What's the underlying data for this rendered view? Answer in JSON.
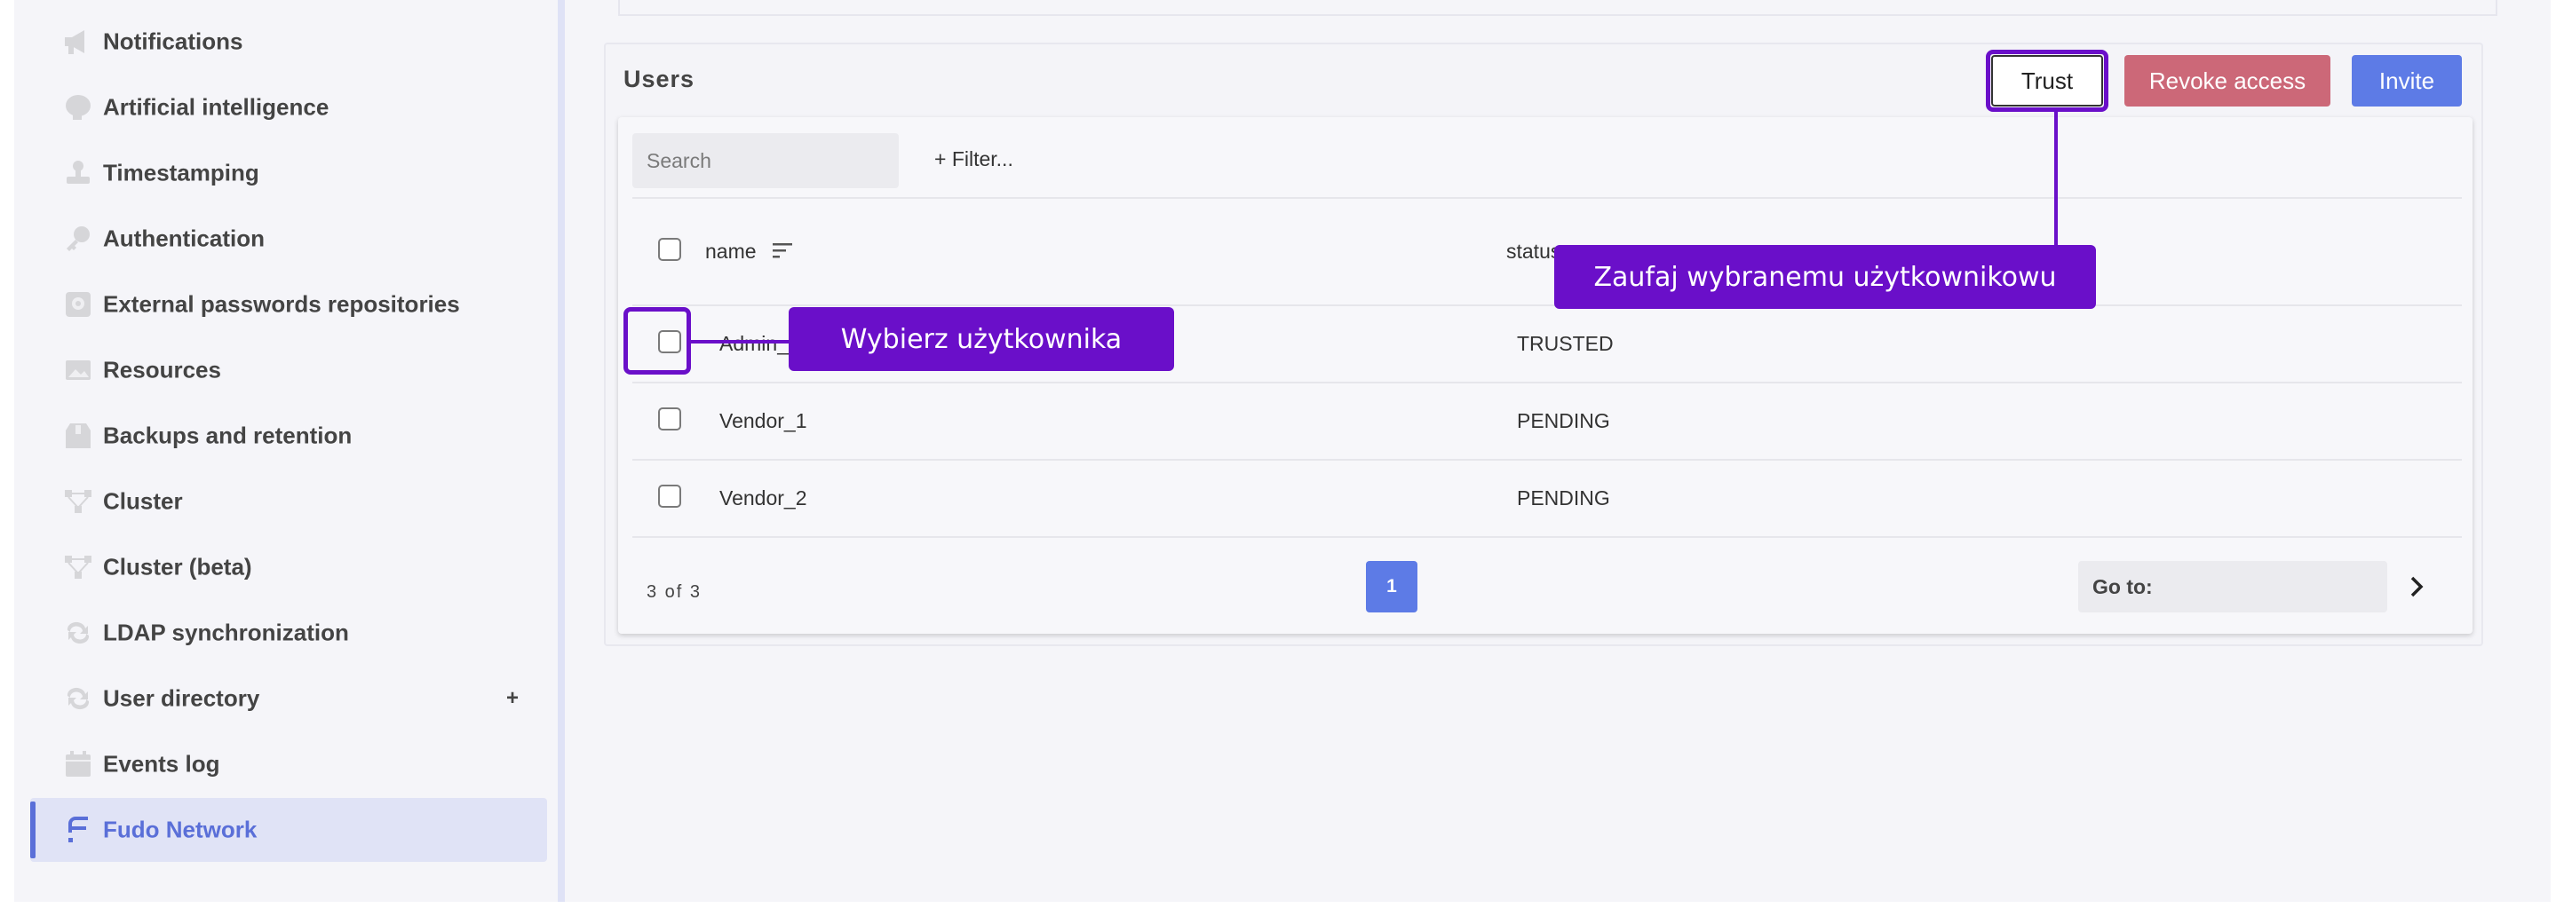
{
  "sidebar": {
    "items": [
      {
        "label": "Notifications",
        "icon": "megaphone-icon"
      },
      {
        "label": "Artificial intelligence",
        "icon": "brain-icon"
      },
      {
        "label": "Timestamping",
        "icon": "stamp-icon"
      },
      {
        "label": "Authentication",
        "icon": "key-icon"
      },
      {
        "label": "External passwords repositories",
        "icon": "vault-icon"
      },
      {
        "label": "Resources",
        "icon": "image-icon"
      },
      {
        "label": "Backups and retention",
        "icon": "archive-box-icon"
      },
      {
        "label": "Cluster",
        "icon": "cluster-icon"
      },
      {
        "label": "Cluster (beta)",
        "icon": "cluster-icon"
      },
      {
        "label": "LDAP synchronization",
        "icon": "sync-icon"
      },
      {
        "label": "User directory",
        "icon": "sync-icon",
        "expand": "+"
      },
      {
        "label": "Events log",
        "icon": "calendar-icon"
      },
      {
        "label": "Fudo Network",
        "icon": "fudo-network-icon",
        "active": true
      }
    ]
  },
  "users": {
    "title": "Users",
    "buttons": {
      "trust": "Trust",
      "revoke": "Revoke access",
      "invite": "Invite"
    },
    "search_placeholder": "Search",
    "filter_label": "+ Filter...",
    "columns": {
      "name": "name",
      "status": "status"
    },
    "rows": [
      {
        "name": "Admin_M",
        "status": "TRUSTED"
      },
      {
        "name": "Vendor_1",
        "status": "PENDING"
      },
      {
        "name": "Vendor_2",
        "status": "PENDING"
      }
    ],
    "pagination": {
      "count": "3 of 3",
      "current_page": "1",
      "goto_placeholder": "Go to:"
    }
  },
  "callouts": {
    "select_user": "Wybierz użytkownika",
    "trust_user": "Zaufaj wybranemu użytkownikowu"
  },
  "colors": {
    "accent": "#5d7be6",
    "callout": "#6a0fc9",
    "revoke": "#cc6878",
    "active_sidebar_text": "#5a6fd8"
  }
}
